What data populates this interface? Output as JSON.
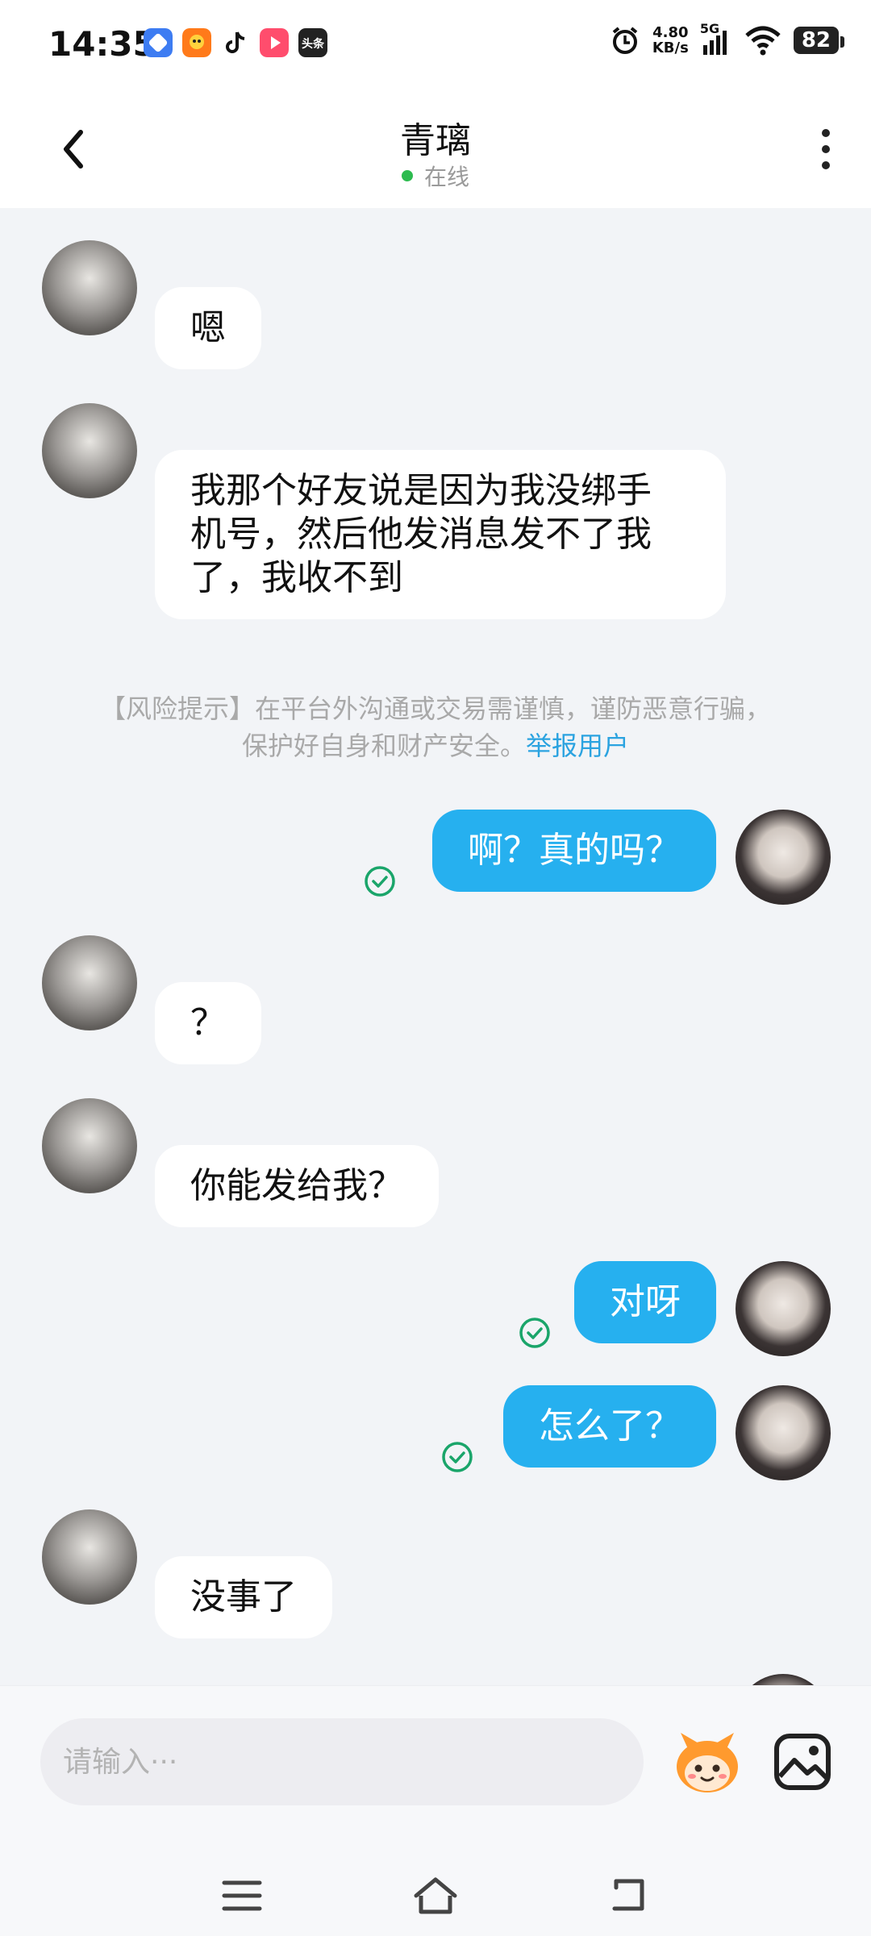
{
  "status_bar": {
    "time": "14:35",
    "net_speed_value": "4.80",
    "net_speed_unit": "KB/s",
    "network": "5G",
    "battery": "82",
    "app_icons": [
      "browser-app-icon",
      "shopping-app-icon",
      "tiktok-icon",
      "video-app-icon",
      "toutiao-icon"
    ],
    "toutiao_label": "头条"
  },
  "header": {
    "title": "青璃",
    "status": "在线",
    "status_color": "#2dbb4f"
  },
  "messages": [
    {
      "from": "them",
      "text": "嗯"
    },
    {
      "from": "them",
      "text_lines": [
        "我那个好友说是因为我没绑手",
        "机号，然后他发消息发不了我",
        "了，我收不到"
      ]
    },
    {
      "from": "me",
      "text": "啊？真的吗？",
      "read": true
    },
    {
      "from": "them",
      "text": "？"
    },
    {
      "from": "them",
      "text": "你能发给我？"
    },
    {
      "from": "me",
      "text": "对呀",
      "read": true
    },
    {
      "from": "me",
      "text": "怎么了？",
      "read": true
    },
    {
      "from": "them",
      "text": "没事了"
    }
  ],
  "risk_notice": {
    "line1": "【风险提示】在平台外沟通或交易需谨慎，谨防恶意行骗，",
    "line2": "保护好自身和财产安全。",
    "link": "举报用户"
  },
  "input": {
    "placeholder": "请输入···"
  },
  "colors": {
    "my_bubble": "#26b0ef",
    "their_bubble": "#ffffff",
    "chat_background": "#f2f4f7",
    "read_check": "#1aa56a",
    "link": "#2ba3e0"
  }
}
